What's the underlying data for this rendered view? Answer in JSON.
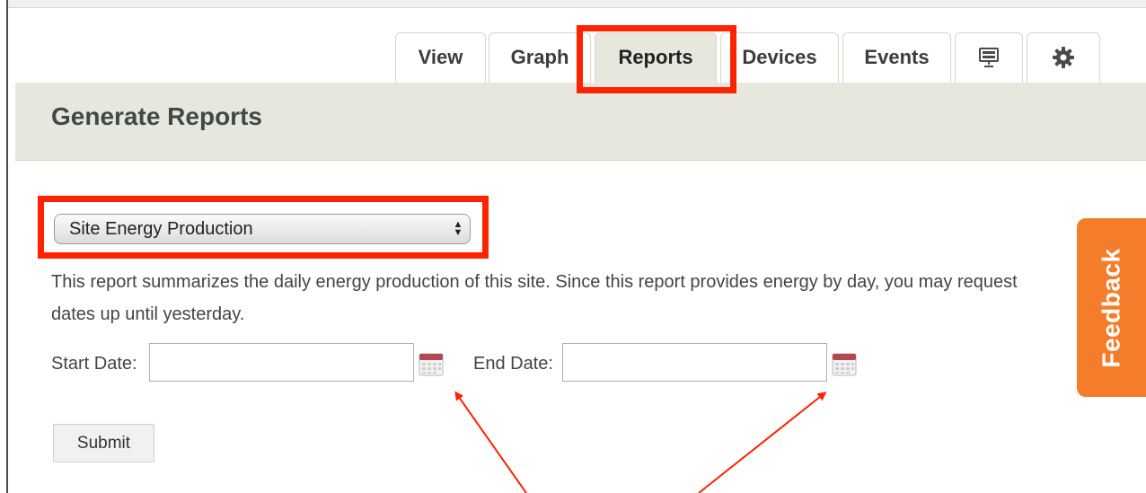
{
  "tabs": [
    {
      "label": "View",
      "active": false
    },
    {
      "label": "Graph",
      "active": false
    },
    {
      "label": "Reports",
      "active": true
    },
    {
      "label": "Devices",
      "active": false
    },
    {
      "label": "Events",
      "active": false
    },
    {
      "icon": "display-board-icon"
    },
    {
      "icon": "gear-icon"
    }
  ],
  "header": {
    "title": "Generate Reports"
  },
  "report_select": {
    "selected": "Site Energy Production"
  },
  "description": "This report summarizes the daily energy production of this site. Since this report provides energy by day, you may request dates up until yesterday.",
  "form": {
    "start_label": "Start Date:",
    "end_label": "End Date:",
    "start_value": "",
    "end_value": "",
    "calendar_icon": "calendar-icon",
    "submit_label": "Submit"
  },
  "feedback": {
    "label": "Feedback",
    "color": "#f47c2a"
  },
  "annotations": {
    "highlight_color": "#ff2200"
  }
}
